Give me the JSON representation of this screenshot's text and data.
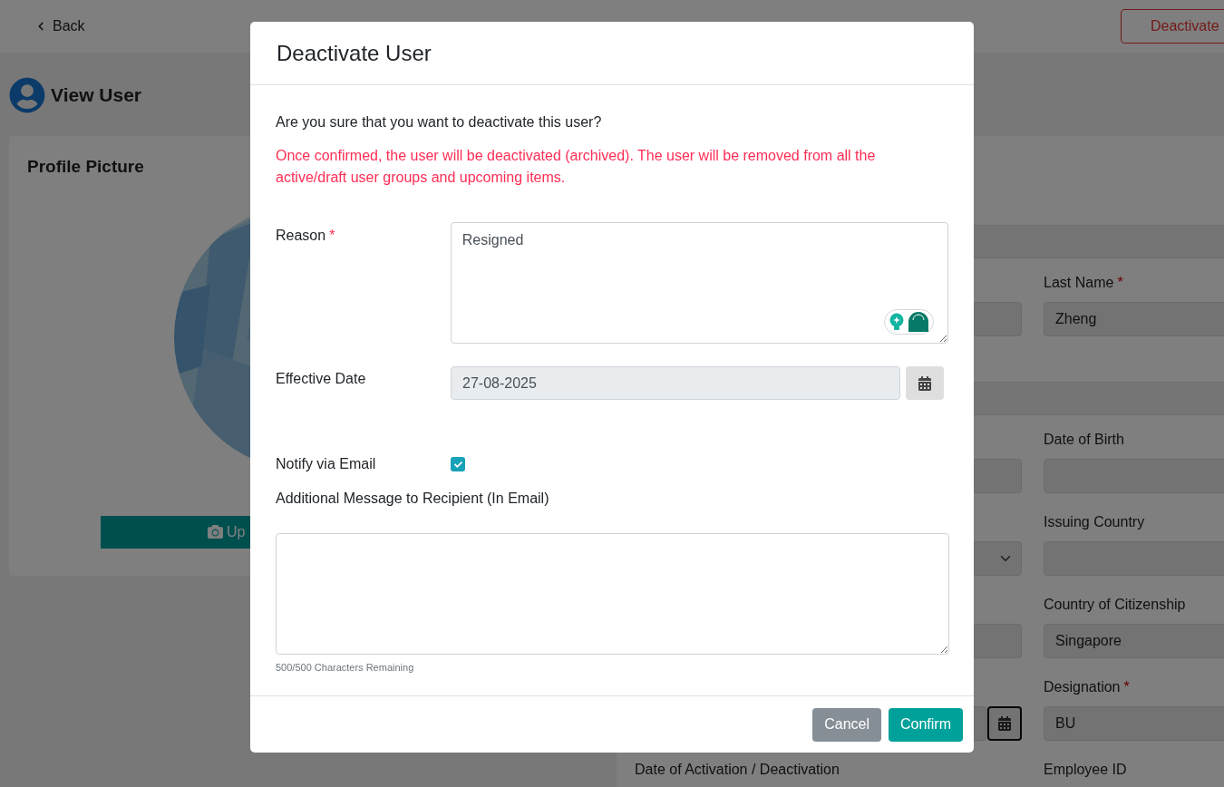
{
  "page": {
    "back_link": "Back",
    "deactivate_button": "Deactivate",
    "title": "View User"
  },
  "profile_card": {
    "title": "Profile Picture",
    "upload_button": "Up"
  },
  "form": {
    "sections": [
      {
        "rows": [
          {
            "left": {
              "kind": "input"
            },
            "right": {
              "kind": "input",
              "label": "Last Name",
              "required_mark": "*",
              "value": "Zheng"
            }
          }
        ]
      },
      {
        "rows": [
          {
            "left": {
              "kind": "input"
            },
            "right": {
              "kind": "input",
              "label": "Date of Birth"
            }
          },
          {
            "left": {
              "kind": "select"
            },
            "right": {
              "kind": "input",
              "label": "Issuing Country"
            }
          },
          {
            "left": {
              "kind": "input"
            },
            "right": {
              "kind": "input",
              "label": "Country of Citizenship",
              "value": "Singapore"
            }
          },
          {
            "left": {
              "kind": "date"
            },
            "right": {
              "kind": "input",
              "label": "Designation",
              "required_mark": "*",
              "value": "BU"
            }
          },
          {
            "left": {
              "kind": "label",
              "label": "Date of Activation / Deactivation"
            },
            "right": {
              "kind": "label",
              "label": "Employee ID"
            }
          }
        ]
      }
    ]
  },
  "dialog": {
    "title": "Deactivate User",
    "question": "Are you sure that you want to deactivate this user?",
    "warning": "Once confirmed, the user will be deactivated (archived). The user will be removed from all the active/draft user groups and upcoming items.",
    "fields": [
      {
        "kind": "textarea",
        "label": "Reason",
        "required_mark": "*",
        "value": "Resigned"
      },
      {
        "kind": "date",
        "label": "Effective Date",
        "disabled": true,
        "value": "27-08-2025"
      },
      {
        "kind": "checkbox",
        "label": "Notify via Email",
        "checked": true
      },
      {
        "kind": "message",
        "label": "Additional Message to Recipient (In Email)",
        "counter": "500/500 Characters Remaining"
      }
    ],
    "buttons": [
      {
        "label": "Cancel",
        "kind": "secondary"
      },
      {
        "label": "Confirm",
        "kind": "primary"
      }
    ]
  }
}
